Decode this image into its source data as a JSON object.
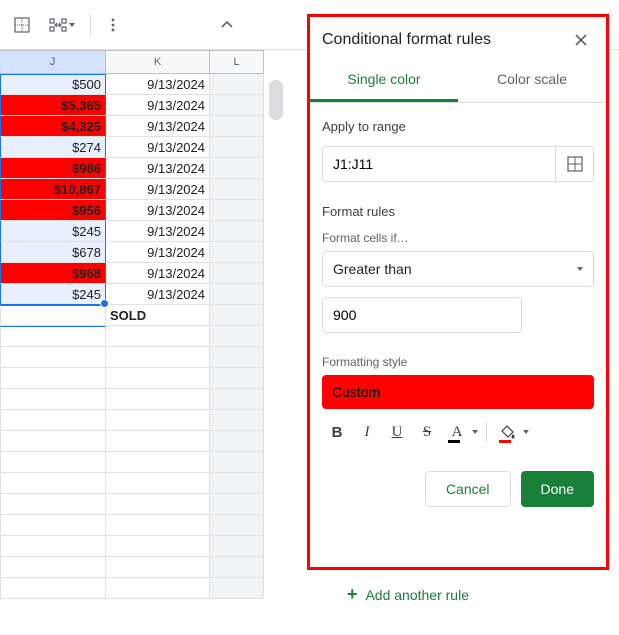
{
  "columns": {
    "j": "J",
    "k": "K",
    "l": "L"
  },
  "rows": [
    {
      "j": "$500",
      "k": "9/13/2024",
      "hl": "none"
    },
    {
      "j": "$5,365",
      "k": "9/13/2024",
      "hl": "cf"
    },
    {
      "j": "$4,325",
      "k": "9/13/2024",
      "hl": "cf"
    },
    {
      "j": "$274",
      "k": "9/13/2024",
      "hl": "none"
    },
    {
      "j": "$986",
      "k": "9/13/2024",
      "hl": "cf"
    },
    {
      "j": "$10,867",
      "k": "9/13/2024",
      "hl": "cf"
    },
    {
      "j": "$956",
      "k": "9/13/2024",
      "hl": "cf"
    },
    {
      "j": "$245",
      "k": "9/13/2024",
      "hl": "none"
    },
    {
      "j": "$678",
      "k": "9/13/2024",
      "hl": "none"
    },
    {
      "j": "$968",
      "k": "9/13/2024",
      "hl": "cf"
    },
    {
      "j": "$245",
      "k": "9/13/2024",
      "hl": "none"
    }
  ],
  "sold_label": "SOLD",
  "panel": {
    "title": "Conditional format rules",
    "tabs": {
      "single": "Single color",
      "scale": "Color scale"
    },
    "apply_label": "Apply to range",
    "range_value": "J1:J11",
    "rules_label": "Format rules",
    "cells_if_label": "Format cells if…",
    "condition": "Greater than",
    "value": "900",
    "style_label": "Formatting style",
    "style_name": "Custom",
    "fmt": {
      "bold": "B",
      "italic": "I",
      "underline": "U",
      "strike": "S",
      "textcolor": "A"
    },
    "cancel": "Cancel",
    "done": "Done",
    "add_rule": "Add another rule"
  }
}
